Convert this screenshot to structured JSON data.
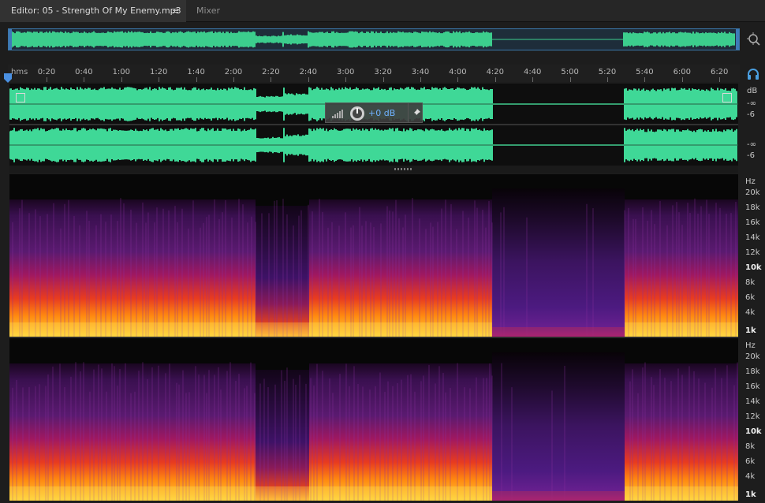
{
  "tabs": {
    "editor": "Editor: 05 - Strength Of My Enemy.mp3",
    "menu_glyph": "≡",
    "mixer": "Mixer"
  },
  "ruler": {
    "label": "hms",
    "ticks": [
      "0:20",
      "0:40",
      "1:00",
      "1:20",
      "1:40",
      "2:00",
      "2:20",
      "2:40",
      "3:00",
      "3:20",
      "3:40",
      "4:00",
      "4:20",
      "4:40",
      "5:00",
      "5:20",
      "5:40",
      "6:00",
      "6:20"
    ]
  },
  "hud": {
    "value": "+0 dB"
  },
  "db_scale": {
    "top": {
      "unit": "dB",
      "minus_inf": "-∞",
      "minus6": "-6"
    },
    "bottom": {
      "minus_inf": "-∞",
      "minus6": "-6"
    }
  },
  "hz_labels": [
    {
      "text": "Hz",
      "bold": false
    },
    {
      "text": "20k",
      "bold": false
    },
    {
      "text": "18k",
      "bold": false
    },
    {
      "text": "16k",
      "bold": false
    },
    {
      "text": "14k",
      "bold": false
    },
    {
      "text": "12k",
      "bold": false
    },
    {
      "text": "10k",
      "bold": true
    },
    {
      "text": "8k",
      "bold": false
    },
    {
      "text": "6k",
      "bold": false
    },
    {
      "text": "4k",
      "bold": false
    },
    {
      "text": "1k",
      "bold": true
    }
  ],
  "colors": {
    "waveform": "#3fd897",
    "overview_waveform": "#3ccd8d",
    "accent": "#3e7ab8",
    "hud_value": "#6fb1ff"
  },
  "icons": {
    "zoom": "zoom-icon",
    "headphones": "headphones-icon",
    "playhead": "playhead-marker",
    "pin": "pin-icon",
    "knob": "volume-knob-icon",
    "level": "level-bars-icon"
  }
}
